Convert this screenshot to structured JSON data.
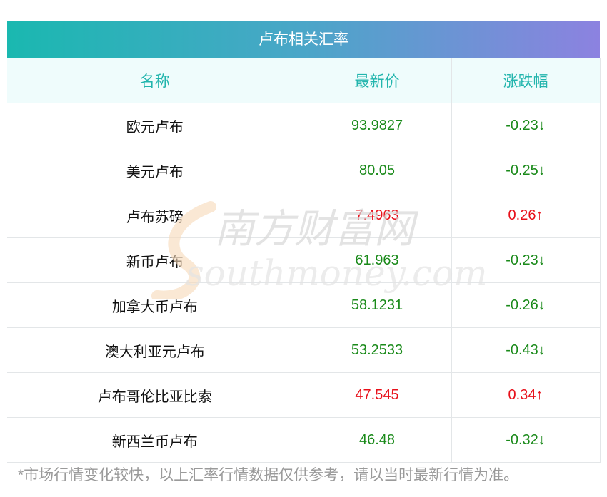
{
  "title": "卢布相关汇率",
  "headers": {
    "name": "名称",
    "price": "最新价",
    "change": "涨跌幅"
  },
  "rows": [
    {
      "name": "欧元卢布",
      "price": "93.9827",
      "change": "-0.23↓",
      "direction": "down"
    },
    {
      "name": "美元卢布",
      "price": "80.05",
      "change": "-0.25↓",
      "direction": "down"
    },
    {
      "name": "卢布苏磅",
      "price": "7.4963",
      "change": "0.26↑",
      "direction": "up"
    },
    {
      "name": "新币卢布",
      "price": "61.963",
      "change": "-0.23↓",
      "direction": "down"
    },
    {
      "name": "加拿大币卢布",
      "price": "58.1231",
      "change": "-0.26↓",
      "direction": "down"
    },
    {
      "name": "澳大利亚元卢布",
      "price": "53.2533",
      "change": "-0.43↓",
      "direction": "down"
    },
    {
      "name": "卢布哥伦比亚比索",
      "price": "47.545",
      "change": "0.34↑",
      "direction": "up"
    },
    {
      "name": "新西兰币卢布",
      "price": "46.48",
      "change": "-0.32↓",
      "direction": "down"
    }
  ],
  "note": "*市场行情变化较快，以上汇率行情数据仅供参考，请以当时最新行情为准。",
  "watermark": {
    "cn": "南方财富网",
    "en": "southmoney.com"
  },
  "colors": {
    "up": "#e8101a",
    "down": "#1a8a1a",
    "header_text": "#22b5ad",
    "gradient_start": "#1ab8b0",
    "gradient_end": "#8c82e0"
  }
}
